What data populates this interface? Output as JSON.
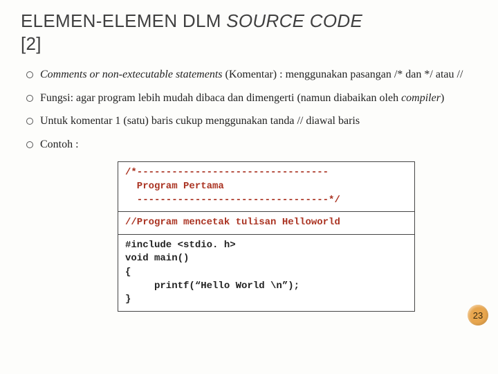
{
  "title": {
    "prefix": "ELEMEN-ELEMEN DLM ",
    "italic": "SOURCE CODE",
    "suffix": " [2]"
  },
  "bullets": [
    {
      "html": "<em>Comments or non-extecutable statements</em> (Komentar) : menggunakan pasangan  /*  dan */  atau //"
    },
    {
      "html": "Fungsi: agar program lebih mudah dibaca dan dimengerti (namun diabaikan oleh <em>compiler</em>)"
    },
    {
      "html": "Untuk komentar 1 (satu) baris cukup menggunakan tanda // diawal baris"
    },
    {
      "html": "Contoh :"
    }
  ],
  "code": {
    "block1": "/*---------------------------------\n  Program Pertama\n  ---------------------------------*/",
    "block2": "//Program mencetak tulisan Helloworld",
    "block3": "#include <stdio. h>\nvoid main()\n{\n     printf(“Hello World \\n”);\n}"
  },
  "pageNumber": "23"
}
